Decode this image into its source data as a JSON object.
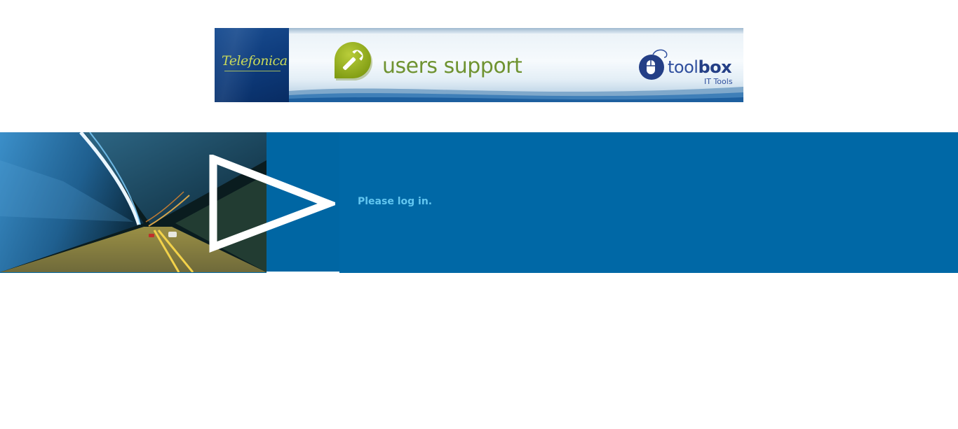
{
  "header": {
    "brand": "Telefonica",
    "title": "users support",
    "toolbox": {
      "word_light": "tool",
      "word_bold": "box",
      "subtitle": "IT Tools"
    },
    "icons": [
      "wrench-icon",
      "mouse-icon"
    ]
  },
  "hero": {
    "message": "Please log in.",
    "icons": [
      "play-triangle-icon"
    ]
  },
  "colors": {
    "hero_blue": "#0068a6",
    "message_text": "#62c6f0",
    "support_green": "#6f9331",
    "brand_green": "#c8d95a",
    "toolbox_blue": "#243f86"
  }
}
